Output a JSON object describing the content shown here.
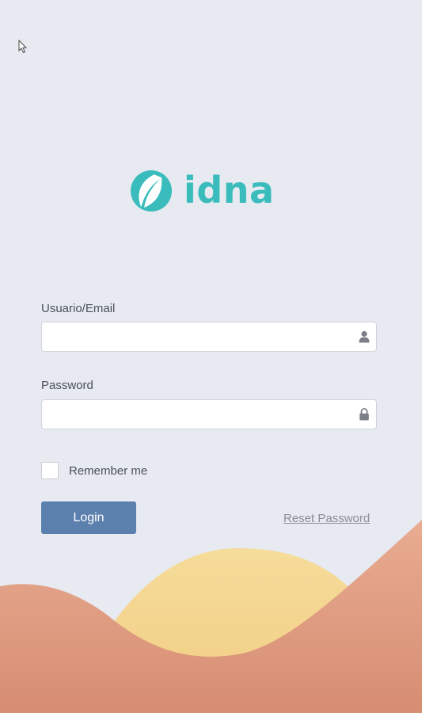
{
  "brand": {
    "name": "idna",
    "color": "#3bbcbc"
  },
  "form": {
    "username": {
      "label": "Usuario/Email",
      "value": "",
      "placeholder": "",
      "icon": "user-icon"
    },
    "password": {
      "label": "Password",
      "value": "",
      "placeholder": "",
      "icon": "lock-icon"
    },
    "remember": {
      "label": "Remember me",
      "checked": false
    },
    "login_label": "Login",
    "reset_label": "Reset Password"
  },
  "colors": {
    "background": "#e7eaf0",
    "button": "#5c80ad",
    "hill_front": "#d99378",
    "hill_back": "#f4d48e"
  }
}
